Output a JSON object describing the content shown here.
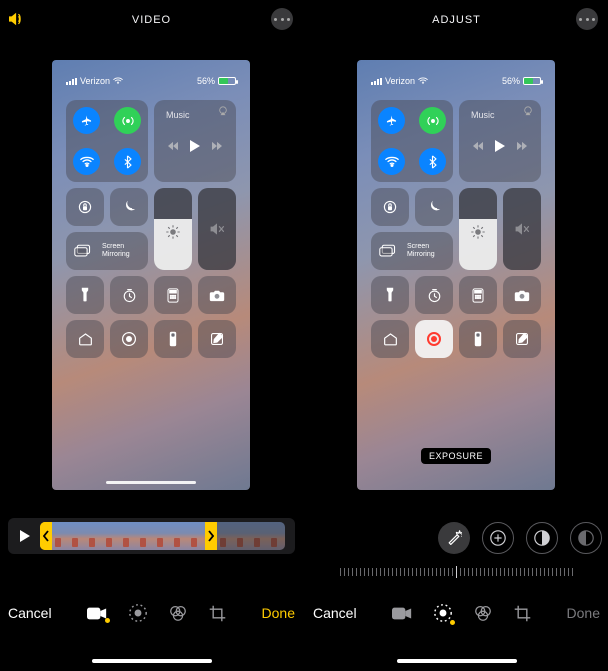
{
  "left": {
    "mode_label": "VIDEO",
    "statusbar": {
      "carrier": "Verizon",
      "battery_pct": "56%"
    },
    "cc": {
      "music_label": "Music",
      "mirror_line1": "Screen",
      "mirror_line2": "Mirroring"
    },
    "bottom": {
      "cancel": "Cancel",
      "done": "Done"
    }
  },
  "right": {
    "mode_label": "ADJUST",
    "statusbar": {
      "carrier": "Verizon",
      "battery_pct": "56%"
    },
    "cc": {
      "music_label": "Music",
      "mirror_line1": "Screen",
      "mirror_line2": "Mirroring"
    },
    "exposure_label": "EXPOSURE",
    "bottom": {
      "cancel": "Cancel",
      "done": "Done"
    }
  },
  "colors": {
    "accent": "#ffcc00"
  }
}
